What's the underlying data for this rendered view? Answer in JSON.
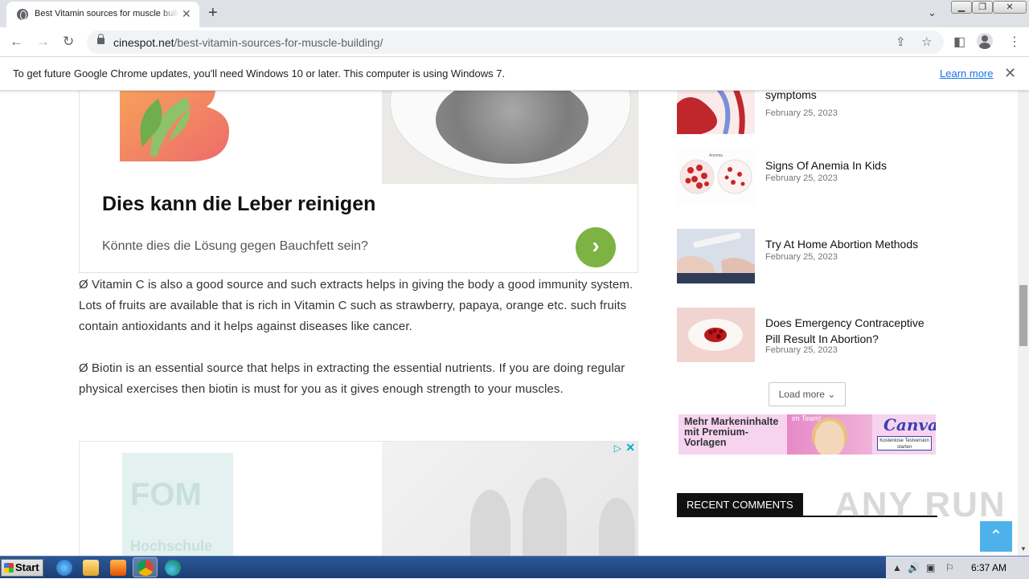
{
  "browser": {
    "tab_title": "Best Vitamin sources for muscle building",
    "url_host": "cinespot.net",
    "url_path": "/best-vitamin-sources-for-muscle-building/",
    "infobar_text": "To get future Google Chrome updates, you'll need Windows 10 or later. This computer is using Windows 7.",
    "infobar_link": "Learn more"
  },
  "ad_top": {
    "headline": "Dies kann die Leber reinigen",
    "subline": "Könnte dies die Lösung gegen Bauchfett sein?",
    "cta_symbol": "›"
  },
  "article": {
    "paragraph_1": "Ø  Vitamin C is also a good source and such extracts helps in giving the body a good immunity system. Lots of fruits are available that is rich in Vitamin C such as strawberry, papaya, orange etc. such fruits contain antioxidants and it helps against diseases like cancer.",
    "paragraph_2": "Ø  Biotin is an essential source that helps in extracting the essential nutrients. If you are doing regular physical exercises then biotin is must for you as it gives enough strength to your muscles."
  },
  "ad_bottom": {
    "logo_text": "FOM",
    "logo_subtext": "Hochschule"
  },
  "sidebar": {
    "posts": [
      {
        "title": "symptoms",
        "date": "February 25, 2023"
      },
      {
        "title": "Signs Of Anemia In Kids",
        "date": "February 25, 2023"
      },
      {
        "title": "Try At Home Abortion Methods",
        "date": "February 25, 2023"
      },
      {
        "title": "Does Emergency Contraceptive Pill Result In Abortion?",
        "date": "February 25, 2023"
      }
    ],
    "load_more": "Load more",
    "canva_ad": {
      "text": "Mehr Markeninhalte mit Premium-Vorlagen",
      "team": "im Team!",
      "logo": "Canva",
      "button": "Kostenlose Testversion starten"
    },
    "recent_comments": "RECENT COMMENTS"
  },
  "watermark": "ANY RUN",
  "taskbar": {
    "start": "Start",
    "clock": "6:37 AM"
  },
  "colors": {
    "accent_green": "#7cb342",
    "back_to_top": "#4db2ec",
    "link_blue": "#1a73e8"
  }
}
